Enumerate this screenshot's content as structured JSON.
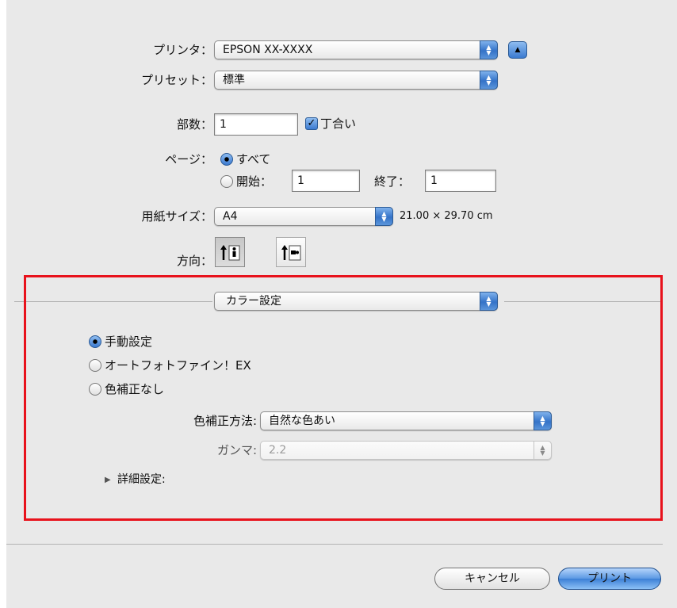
{
  "printer": {
    "label": "プリンタ：",
    "value": "EPSON XX-XXXX"
  },
  "preset": {
    "label": "プリセット：",
    "value": "標準"
  },
  "copies": {
    "label": "部数：",
    "value": "1",
    "collate_label": "丁合い",
    "collate_checked": true
  },
  "pages": {
    "label": "ページ：",
    "all_label": "すべて",
    "from_label": "開始：",
    "from_value": "1",
    "to_label": "終了：",
    "to_value": "1",
    "selected": "all"
  },
  "paper_size": {
    "label": "用紙サイズ：",
    "value": "A4",
    "dimensions": "21.00 × 29.70 cm"
  },
  "orientation": {
    "label": "方向：",
    "selected": "portrait"
  },
  "panel": {
    "value": "カラー設定"
  },
  "color_mode": {
    "options": [
      "手動設定",
      "オートフォトファイン！EX",
      "色補正なし"
    ],
    "selected": 0
  },
  "color_method": {
    "label": "色補正方法:",
    "value": "自然な色あい"
  },
  "gamma": {
    "label": "ガンマ:",
    "value": "2.2",
    "disabled": true
  },
  "advanced": {
    "label": "詳細設定:"
  },
  "buttons": {
    "cancel": "キャンセル",
    "print": "プリント"
  },
  "colors": {
    "highlight": "#e8121c",
    "accent": "#3b7ad0"
  }
}
